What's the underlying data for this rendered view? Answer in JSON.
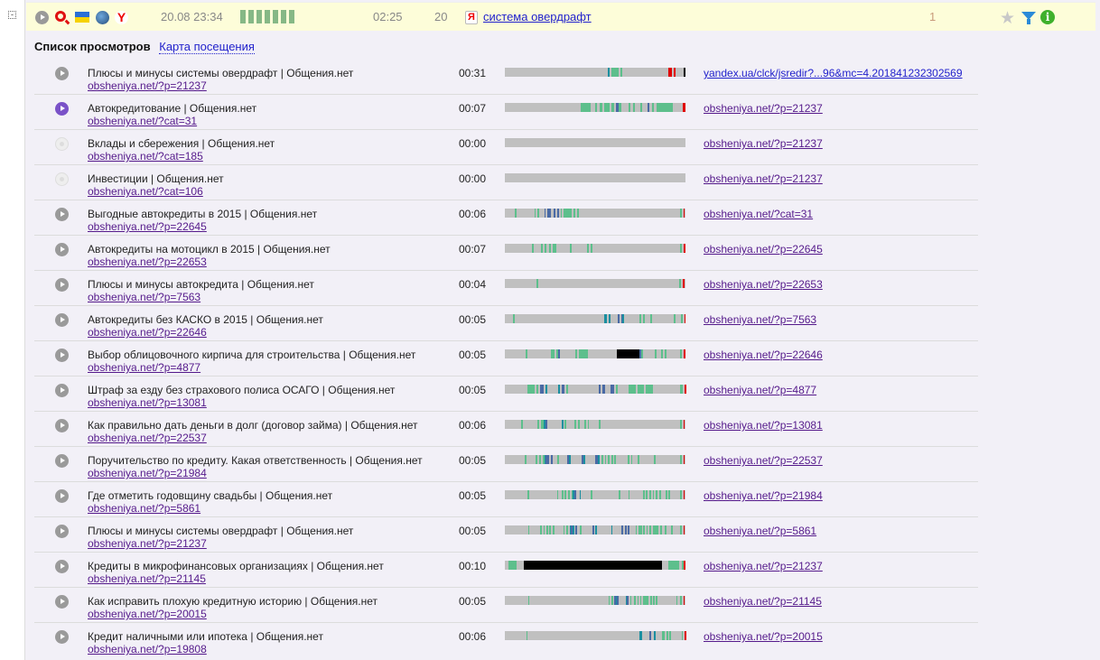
{
  "header": {
    "date": "20.08 23:34",
    "activity_blocks": 7,
    "duration": "02:25",
    "pages": "20",
    "search_engine_icon": "Я",
    "query": "система овердрафт",
    "count": "1",
    "icons": [
      "play-icon",
      "search-icon",
      "ukraine-flag-icon",
      "windows-icon",
      "yandex-browser-icon",
      "star-icon",
      "filter-icon",
      "info-icon"
    ]
  },
  "tabs": {
    "list": "Список просмотров",
    "map": "Карта посещения"
  },
  "colors": {
    "gray": "#c0c0c0",
    "g": "#5dbf8c",
    "b": "#4a6aa5",
    "t": "#1a8fa0",
    "r": "#e00000",
    "k": "#000000"
  },
  "rows": [
    {
      "title": "Плюсы и минусы системы овердрафт | Общения.нет",
      "url": "obsheniya.net/?p=21237",
      "time": "00:31",
      "ref": "yandex.ua/clck/jsredir?...96&mc=4.201841232302569",
      "state": "normal",
      "track": "............................................................t.gggg.g...........................rr.r.....k"
    },
    {
      "title": "Автокредитование | Общения.нет",
      "url": "obsheniya.net/?cat=31",
      "time": "00:07",
      "ref": "obsheniya.net/?p=21237",
      "state": "active",
      "track": "................................gggg..g.g.gg.g.bg...g.g..g..b.g.ggggggg....r"
    },
    {
      "title": "Вклады и сбережения | Общения.нет",
      "url": "obsheniya.net/?cat=185",
      "time": "00:00",
      "ref": "obsheniya.net/?p=21237",
      "state": "empty",
      "track": "...................................................................................................."
    },
    {
      "title": "Инвестиции | Общения.нет",
      "url": "obsheniya.net/?cat=106",
      "time": "00:00",
      "ref": "obsheniya.net/?p=21237",
      "state": "empty",
      "track": "...................................................................................................."
    },
    {
      "title": "Выгодные автокредиты в 2015 | Общения.нет",
      "url": "obsheniya.net/?p=22645",
      "time": "00:06",
      "ref": "obsheniya.net/?cat=31",
      "state": "normal",
      "track": "......g...........g.g...b.bb..b.b.g.ggggg.g.g..............................................................g.r"
    },
    {
      "title": "Автокредиты на мотоцикл в 2015 | Общения.нет",
      "url": "obsheniya.net/?p=22653",
      "time": "00:07",
      "ref": "obsheniya.net/?p=22645",
      "state": "normal",
      "track": "..............g....g.g.g.gg.......g........g.g..............................................g.r"
    },
    {
      "title": "Плюсы и минусы автокредита | Общения.нет",
      "url": "obsheniya.net/?p=7563",
      "time": "00:04",
      "ref": "obsheniya.net/?p=22653",
      "state": "normal",
      "track": "..................g................................................................................g.r"
    },
    {
      "title": "Автокредиты без КАСКО в 2015 | Общения.нет",
      "url": "obsheniya.net/?p=22646",
      "time": "00:05",
      "ref": "obsheniya.net/?p=7563",
      "state": "normal",
      "track": ".....g....................................................tt.t....b.bt.........g.g...g.............g...g.r"
    },
    {
      "title": "Выбор облицовочного кирпича для строительства | Общения.нет",
      "url": "obsheniya.net/?p=4877",
      "time": "00:05",
      "ref": "obsheniya.net/?p=22646",
      "state": "normal",
      "track": "............g..............gg.gb.........g.ggggg.................kkkkkkkkkkkkkbg.......g...g.g........g.r"
    },
    {
      "title": "Штраф за езду без страхового полиса ОСАГО | Общения.нет",
      "url": "obsheniya.net/?p=13081",
      "time": "00:05",
      "ref": "obsheniya.net/?p=4877",
      "state": "normal",
      "track": "............gggg.g.bb.t......t.b.g.................b.b...bb.g......gggg.ggg.gggg...............g.r"
    },
    {
      "title": "Как правильно дать деньги в долг (договор займа) | Общения.нет",
      "url": "obsheniya.net/?p=22537",
      "time": "00:06",
      "ref": "obsheniya.net/?p=13081",
      "state": "normal",
      "track": "..........g.........g.ggtb.........t.g.....g.g...g.g......g.................................................g.r"
    },
    {
      "title": "Поручительство по кредиту. Какая ответственность | Общения.нет",
      "url": "obsheniya.net/?p=21984",
      "time": "00:05",
      "ref": "obsheniya.net/?p=22537",
      "state": "normal",
      "track": "............g......g.g.gtbb.b...g.....bt.......bt......bbt.g.g.g.g.g.......g.g...g.........g...............g.r"
    },
    {
      "title": "Где отметить годовщину свадьбы | Общения.нет",
      "url": "obsheniya.net/?p=5861",
      "time": "00:05",
      "ref": "obsheniya.net/?p=21984",
      "state": "normal",
      "track": "..............g.................g..g.g.g.gtb..t......g................g.....g........g.g.g.g.g.g...g.g......g.r"
    },
    {
      "title": "Плюсы и минусы системы овердрафт | Общения.нет",
      "url": "obsheniya.net/?p=21237",
      "time": "00:05",
      "ref": "obsheniya.net/?p=5861",
      "state": "normal",
      "track": "...............g.......g.g.g.g.g......g.g.tbt.b..g.......b.t.........t......b.b.b....g.gg.g.g.g.gggg.g..g...g.....g.r"
    },
    {
      "title": "Кредиты в микрофинансовых организациях | Общения.нет",
      "url": "obsheniya.net/?p=21145",
      "time": "00:10",
      "ref": "obsheniya.net/?p=21237",
      "state": "normal",
      "track": "..gggg....kkkkkkkkkkkkkkkkkkkkkkkkkkkkkkkkkkkkkkkkkkkkkkkkkkkkkkkkkkkkkkkkkkkkkkkk...gggggg.gr"
    },
    {
      "title": "Как исправить плохую кредитную историю | Общения.нет",
      "url": "obsheniya.net/?p=20015",
      "time": "00:05",
      "ref": "obsheniya.net/?p=21145",
      "state": "normal",
      "track": "................g.......................................................g.g.btb.....tb.g..g.g.g.gggg.g.g.g.............g..g.r"
    },
    {
      "title": "Кредит наличными или ипотека | Общения.нет",
      "url": "obsheniya.net/?p=19808",
      "time": "00:06",
      "ref": "obsheniya.net/?p=20015",
      "state": "normal",
      "track": "..............g.........................................................................tt.....b..t....gg.g.g.......g.r"
    }
  ]
}
